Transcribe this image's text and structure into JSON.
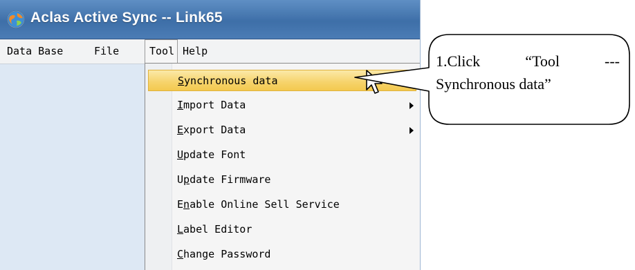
{
  "window": {
    "title": "Aclas Active Sync -- Link65",
    "icon": "app-globe-icon"
  },
  "menubar": {
    "items": [
      {
        "label": "Data Base"
      },
      {
        "label": "File"
      },
      {
        "label": "Tool",
        "active": true
      },
      {
        "label": "Help"
      }
    ]
  },
  "tool_menu": {
    "items": [
      {
        "label": "Synchronous data",
        "mnemonic": "S",
        "rest": "ynchronous data",
        "highlighted": true
      },
      {
        "label": "Import Data",
        "mnemonic": "I",
        "rest": "mport Data",
        "submenu": true
      },
      {
        "label": "Export Data",
        "mnemonic": "E",
        "rest": "xport Data",
        "submenu": true
      },
      {
        "label": "Update Font",
        "mnemonic": "U",
        "rest": "pdate Font"
      },
      {
        "label": "Update Firmware",
        "pre": "U",
        "mnemonic": "p",
        "rest": "date Firmware"
      },
      {
        "label": "Enable Online Sell Service",
        "pre": "E",
        "mnemonic": "n",
        "rest": "able Online Sell Service"
      },
      {
        "label": "Label Editor",
        "mnemonic": "L",
        "rest": "abel Editor"
      },
      {
        "label": "Change Password",
        "mnemonic": "C",
        "rest": "hange Password"
      }
    ]
  },
  "callout": {
    "line1_left": "1.Click",
    "line1_mid": "“Tool",
    "line1_right": "---",
    "line2": "Synchronous data”"
  },
  "colors": {
    "titlebar": "#3e6fa8",
    "highlight": "#f6d36a",
    "client": "#dde8f4"
  }
}
